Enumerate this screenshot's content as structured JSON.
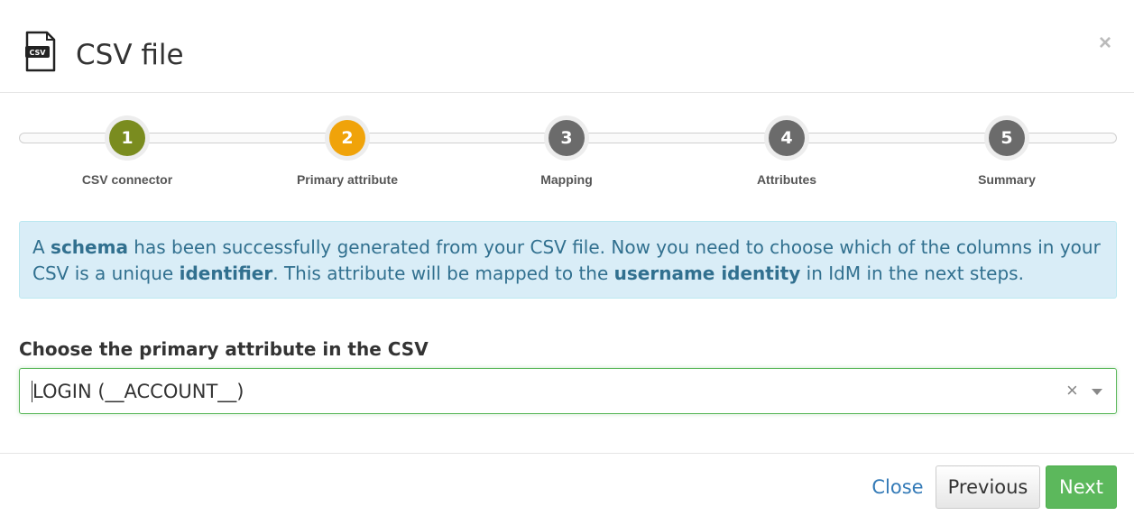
{
  "modal": {
    "title": "CSV file",
    "icon": "csv-file-icon",
    "icon_text": "CSV",
    "close_symbol": "×"
  },
  "wizard": {
    "steps": [
      {
        "number": "1",
        "label": "CSV connector",
        "state": "done",
        "color": "#7a8c1f"
      },
      {
        "number": "2",
        "label": "Primary attribute",
        "state": "active",
        "color": "#f0a30a"
      },
      {
        "number": "3",
        "label": "Mapping",
        "state": "pending",
        "color": "#6b6b6b"
      },
      {
        "number": "4",
        "label": "Attributes",
        "state": "pending",
        "color": "#6b6b6b"
      },
      {
        "number": "5",
        "label": "Summary",
        "state": "pending",
        "color": "#6b6b6b"
      }
    ]
  },
  "alert": {
    "t1": "A ",
    "b1": "schema",
    "t2": " has been successfully generated from your CSV file. Now you need to choose which of the columns in your CSV is a unique ",
    "b2": "identifier",
    "t3": ". This attribute will be mapped to the ",
    "b3": "username identity",
    "t4": " in IdM in the next steps."
  },
  "field": {
    "label": "Choose the primary attribute in the CSV",
    "value": "LOGIN (__ACCOUNT__)",
    "clear_symbol": "×"
  },
  "footer": {
    "close_label": "Close",
    "previous_label": "Previous",
    "next_label": "Next"
  },
  "colors": {
    "accent_link": "#337ab7",
    "success": "#5cb85c",
    "alert_bg": "#d9edf7",
    "alert_text": "#31708f"
  }
}
